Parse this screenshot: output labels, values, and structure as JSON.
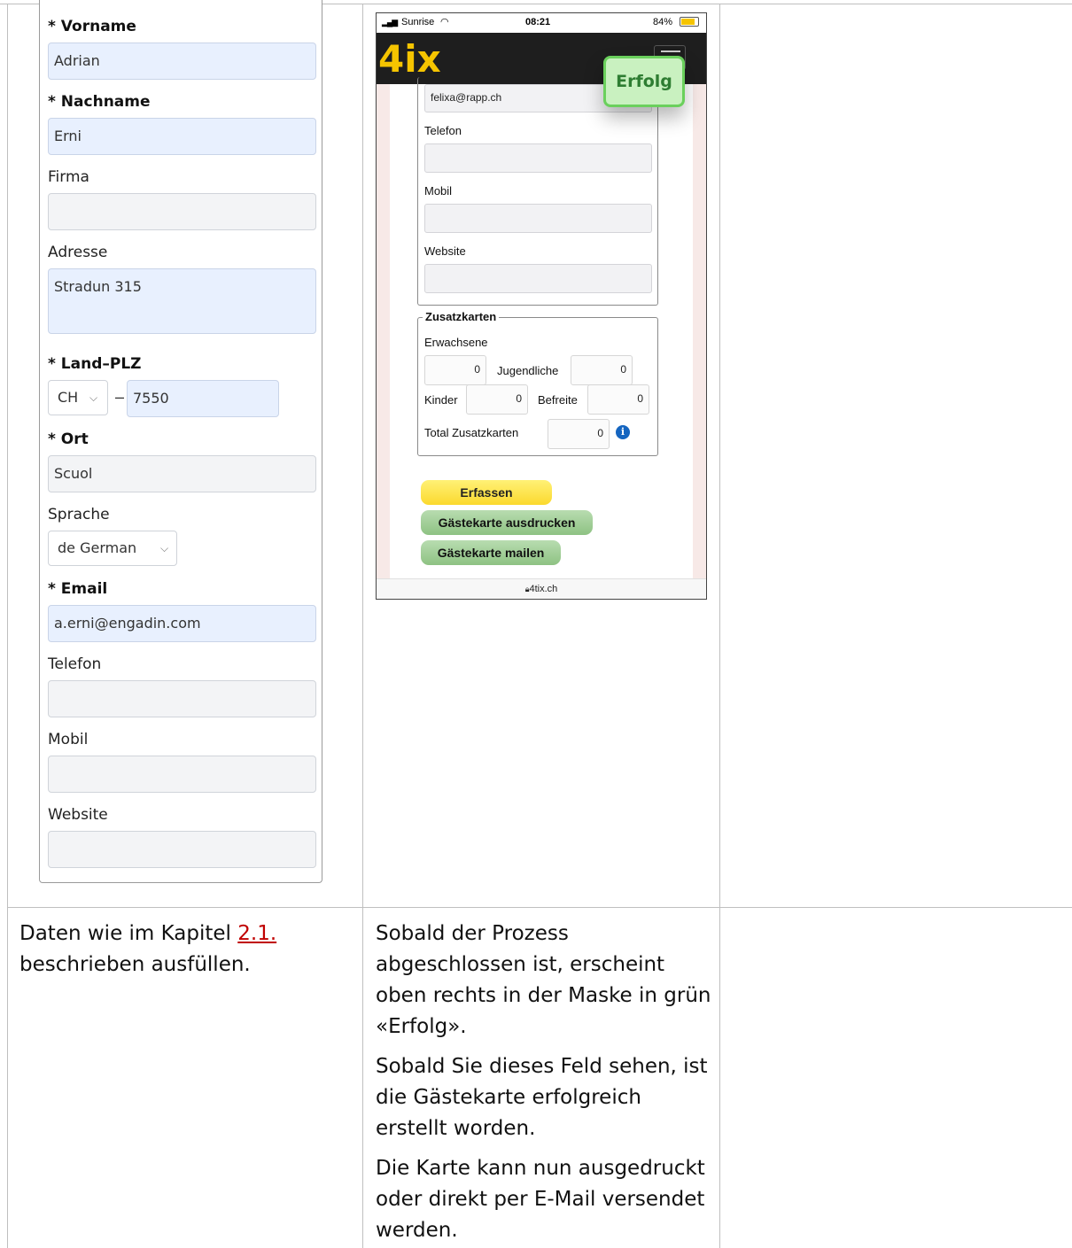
{
  "form": {
    "vorname_label": "* Vorname",
    "vorname_value": "Adrian",
    "nachname_label": "* Nachname",
    "nachname_value": "Erni",
    "firma_label": "Firma",
    "firma_value": "",
    "adresse_label": "Adresse",
    "adresse_value": "Stradun 315",
    "land_plz_label": "* Land–PLZ",
    "land_value": "CH",
    "land_dash": "–",
    "plz_value": "7550",
    "ort_label": "* Ort",
    "ort_value": "Scuol",
    "sprache_label": "Sprache",
    "sprache_value": "de German",
    "email_label": "* Email",
    "email_value": "a.erni@engadin.com",
    "telefon_label": "Telefon",
    "telefon_value": "",
    "mobil_label": "Mobil",
    "mobil_value": "",
    "website_label": "Website",
    "website_value": ""
  },
  "phone": {
    "carrier": "Sunrise",
    "time": "08:21",
    "battery": "84%",
    "logo_digit": "4",
    "logo_letters": "ix",
    "email_value": "felixa@rapp.ch",
    "telefon_label": "Telefon",
    "mobil_label": "Mobil",
    "website_label": "Website",
    "zusatz_legend": "Zusatzkarten",
    "erwachsene_label": "Erwachsene",
    "erwachsene_value": "0",
    "jugendliche_label": "Jugendliche",
    "jugendliche_value": "0",
    "kinder_label": "Kinder",
    "kinder_value": "0",
    "befreite_label": "Befreite",
    "befreite_value": "0",
    "total_label": "Total Zusatzkarten",
    "total_value": "0",
    "btn_erfassen": "Erfassen",
    "btn_ausdrucken": "Gästekarte ausdrucken",
    "btn_mailen": "Gästekarte mailen",
    "url": "4tix.ch",
    "toast": "Erfolg"
  },
  "text": {
    "left_pre": "Daten wie im Kapitel",
    "left_link": "2.1.",
    "left_post": "beschrieben ausfüllen.",
    "middle_p1": "Sobald der Prozess abgeschlossen ist, erscheint oben rechts in der Maske in grün «Erfolg».",
    "middle_p2": "Sobald Sie dieses Feld sehen, ist die Gästekarte erfolgreich erstellt worden.",
    "middle_p3": "Die Karte kann nun ausgedruckt oder direkt per E-Mail versendet werden."
  },
  "colors": {
    "toast_green": "#6ad05c",
    "button_yellow": "#fbd92e",
    "button_green": "#8ec283",
    "link_red": "#c00000",
    "logo_yellow": "#f5c400"
  }
}
